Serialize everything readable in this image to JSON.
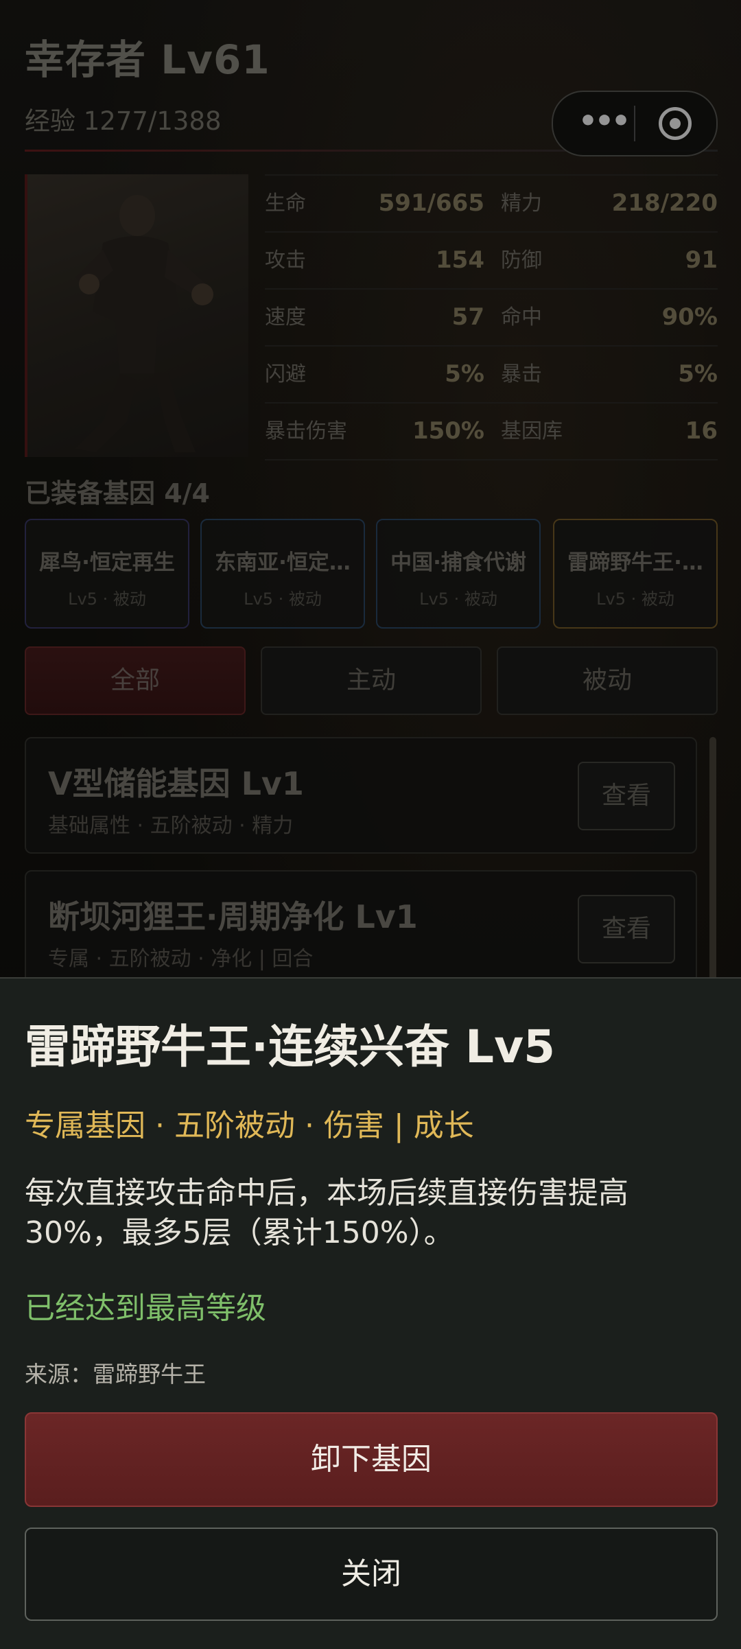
{
  "header": {
    "title": "幸存者 Lv61",
    "exp_label": "经验 1277/1388"
  },
  "stats": [
    {
      "label": "生命",
      "value": "591/665",
      "label2": "精力",
      "value2": "218/220"
    },
    {
      "label": "攻击",
      "value": "154",
      "label2": "防御",
      "value2": "91"
    },
    {
      "label": "速度",
      "value": "57",
      "label2": "命中",
      "value2": "90%"
    },
    {
      "label": "闪避",
      "value": "5%",
      "label2": "暴击",
      "value2": "5%"
    },
    {
      "label": "暴击伤害",
      "value": "150%",
      "label2": "基因库",
      "value2": "16"
    }
  ],
  "equipped": {
    "title": "已装备基因 4/4",
    "slots": [
      {
        "name": "犀鸟·恒定再生",
        "sub": "Lv5 · 被动",
        "border": "#3b3a6a"
      },
      {
        "name": "东南亚·恒定…",
        "sub": "Lv5 · 被动",
        "border": "#2e4a6a"
      },
      {
        "name": "中国·捕食代谢",
        "sub": "Lv5 · 被动",
        "border": "#2e4a6a"
      },
      {
        "name": "雷蹄野牛王·…",
        "sub": "Lv5 · 被动",
        "border": "#7a5f2a"
      }
    ]
  },
  "filters": {
    "all": "全部",
    "active": "主动",
    "passive": "被动"
  },
  "gene_list": [
    {
      "title": "V型储能基因 Lv1",
      "sub": "基础属性 · 五阶被动 · 精力",
      "view": "查看"
    },
    {
      "title": "断坝河狸王·周期净化 Lv1",
      "sub": "专属 · 五阶被动 · 净化 | 回合",
      "view": "查看"
    }
  ],
  "detail": {
    "title": "雷蹄野牛王·连续兴奋 Lv5",
    "tags": "专属基因 · 五阶被动 · 伤害 | 成长",
    "description": "每次直接攻击命中后，本场后续直接伤害提高30%，最多5层（累计150%）。",
    "max_level": "已经达到最高等级",
    "source": "来源：雷蹄野牛王",
    "unequip": "卸下基因",
    "close": "关闭"
  },
  "colors": {
    "accent_red": "#6b2626",
    "tag_gold": "#e0b857",
    "max_green": "#7fbf6a"
  },
  "icons": {
    "more": "more-dots-icon",
    "close_mini": "target-circle-icon"
  }
}
